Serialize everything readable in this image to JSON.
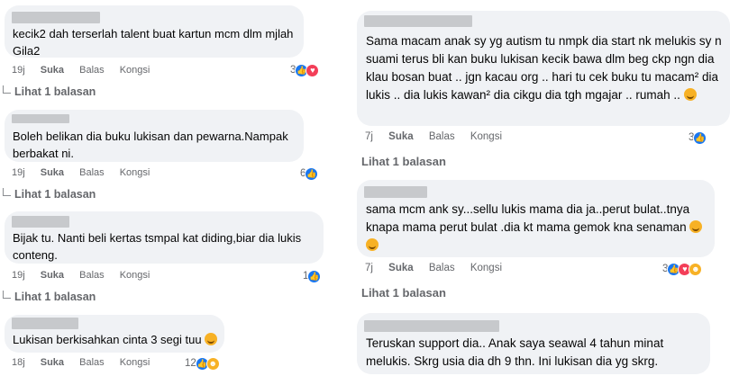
{
  "left": [
    {
      "text": "kecik2 dah terserlah talent buat kartun mcm dlm mjlah Gila2",
      "time": "19j",
      "react_count": "3",
      "reactions": [
        "like",
        "love"
      ],
      "replies": "Lihat 1 balasan"
    },
    {
      "text": "Boleh belikan dia buku lukisan dan pewarna.Nampak berbakat ni.",
      "time": "19j",
      "react_count": "6",
      "reactions": [
        "like"
      ],
      "replies": "Lihat 1 balasan"
    },
    {
      "text": "Bijak tu. Nanti beli kertas tsmpal kat diding,biar dia lukis conteng.",
      "time": "19j",
      "react_count": "1",
      "reactions": [
        "like"
      ],
      "replies": "Lihat 1 balasan"
    },
    {
      "text": "Lukisan berkisahkan cinta 3 segi tuu",
      "time": "18j",
      "react_count": "12",
      "reactions": [
        "like",
        "haha"
      ],
      "replies": ""
    }
  ],
  "right": [
    {
      "text": "Sama macam anak sy yg autism tu nmpk dia start nk melukis sy n suami terus bli kan buku lukisan kecik bawa dlm beg ckp ngn dia klau bosan buat .. jgn kacau org .. hari tu cek buku tu macam² dia lukis .. dia lukis kawan² dia cikgu dia tgh mgajar .. rumah ..",
      "time": "7j",
      "react_count": "3",
      "reactions": [
        "like"
      ],
      "replies": "Lihat 1 balasan"
    },
    {
      "text": "sama mcm ank sy...sellu lukis mama dia ja..perut bulat..tnya knapa mama perut bulat .dia kt mama gemok kna senaman",
      "time": "7j",
      "react_count": "3",
      "reactions": [
        "like",
        "love",
        "haha"
      ],
      "replies": "Lihat 1 balasan"
    },
    {
      "text": "Teruskan support dia.. Anak saya seawal 4 tahun minat melukis. Skrg usia dia dh 9 thn. Ini lukisan dia yg skrg.",
      "time": "",
      "react_count": "",
      "reactions": [],
      "replies": ""
    }
  ],
  "labels": {
    "like": "Suka",
    "reply": "Balas",
    "share": "Kongsi"
  },
  "colors": {
    "bubble": "#f0f2f5",
    "meta": "#65676b",
    "like": "#1877f2",
    "love": "#f33e58",
    "haha": "#f7b125"
  }
}
